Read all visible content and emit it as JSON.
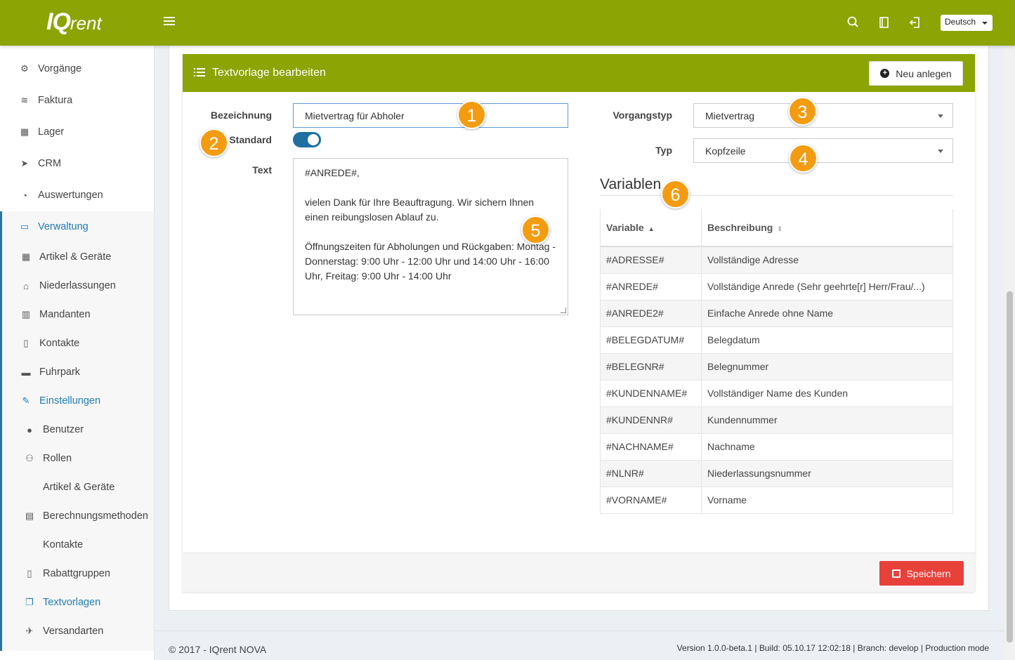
{
  "app": {
    "logo_main": "IQ",
    "logo_small": "rent",
    "language": "Deutsch"
  },
  "sidebar": {
    "items": [
      {
        "label": "Vorgänge",
        "icon": "gears-icon"
      },
      {
        "label": "Faktura",
        "icon": "layers-icon"
      },
      {
        "label": "Lager",
        "icon": "boxes-icon"
      },
      {
        "label": "CRM",
        "icon": "paper-plane-icon"
      },
      {
        "label": "Auswertungen",
        "icon": "pie-chart-icon"
      },
      {
        "label": "Verwaltung",
        "icon": "folder-icon"
      },
      {
        "label": "Artikel & Geräte",
        "icon": "grid-icon"
      },
      {
        "label": "Niederlassungen",
        "icon": "home-icon"
      },
      {
        "label": "Mandanten",
        "icon": "building-icon"
      },
      {
        "label": "Kontakte",
        "icon": "address-book-icon"
      },
      {
        "label": "Fuhrpark",
        "icon": "car-icon"
      },
      {
        "label": "Einstellungen",
        "icon": "wrench-icon"
      },
      {
        "label": "Benutzer",
        "icon": "user-icon"
      },
      {
        "label": "Rollen",
        "icon": "users-icon"
      },
      {
        "label": "Artikel & Geräte",
        "icon": ""
      },
      {
        "label": "Berechnungsmethoden",
        "icon": "calculator-icon"
      },
      {
        "label": "Kontakte",
        "icon": ""
      },
      {
        "label": "Rabattgruppen",
        "icon": "book-icon"
      },
      {
        "label": "Textvorlagen",
        "icon": "copy-icon"
      },
      {
        "label": "Versandarten",
        "icon": "rocket-icon"
      }
    ]
  },
  "panel": {
    "title": "Textvorlage bearbeiten",
    "new_button": "Neu anlegen",
    "save_button": "Speichern"
  },
  "form": {
    "bezeichnung_label": "Bezeichnung",
    "bezeichnung_value": "Mietvertrag für Abholer",
    "standard_label": "Standard",
    "standard_on": true,
    "text_label": "Text",
    "text_value": "#ANREDE#,\n\nvielen Dank für Ihre Beauftragung. Wir sichern Ihnen einen reibungslosen Ablauf zu.\n\nÖffnungszeiten für Abholungen und Rückgaben: Montag - Donnerstag: 9:00 Uhr - 12:00 Uhr und 14:00 Uhr - 16:00 Uhr, Freitag: 9:00 Uhr - 14:00 Uhr",
    "vorgangstyp_label": "Vorgangstyp",
    "vorgangstyp_value": "Mietvertrag",
    "typ_label": "Typ",
    "typ_value": "Kopfzeile"
  },
  "variables": {
    "title": "Variablen",
    "columns": [
      "Variable",
      "Beschreibung"
    ],
    "rows": [
      [
        "#ADRESSE#",
        "Vollständige Adresse"
      ],
      [
        "#ANREDE#",
        "Vollständige Anrede (Sehr geehrte[r] Herr/Frau/...)"
      ],
      [
        "#ANREDE2#",
        "Einfache Anrede ohne Name"
      ],
      [
        "#BELEGDATUM#",
        "Belegdatum"
      ],
      [
        "#BELEGNR#",
        "Belegnummer"
      ],
      [
        "#KUNDENNAME#",
        "Vollständiger Name des Kunden"
      ],
      [
        "#KUNDENNR#",
        "Kundennummer"
      ],
      [
        "#NACHNAME#",
        "Nachname"
      ],
      [
        "#NLNR#",
        "Niederlassungsnummer"
      ],
      [
        "#VORNAME#",
        "Vorname"
      ]
    ]
  },
  "badges": [
    "1",
    "2",
    "3",
    "4",
    "5",
    "6"
  ],
  "footer": {
    "copyright": "© 2017 - IQrent NOVA",
    "version": "Version 1.0.0-beta.1 | Build: 05.10.17 12:02:18 | Branch: develop | Production mode"
  },
  "colors": {
    "brand": "#8ca404",
    "accent_blue": "#1f7bb5",
    "save_red": "#e8413a",
    "badge_orange": "#f39c12"
  }
}
